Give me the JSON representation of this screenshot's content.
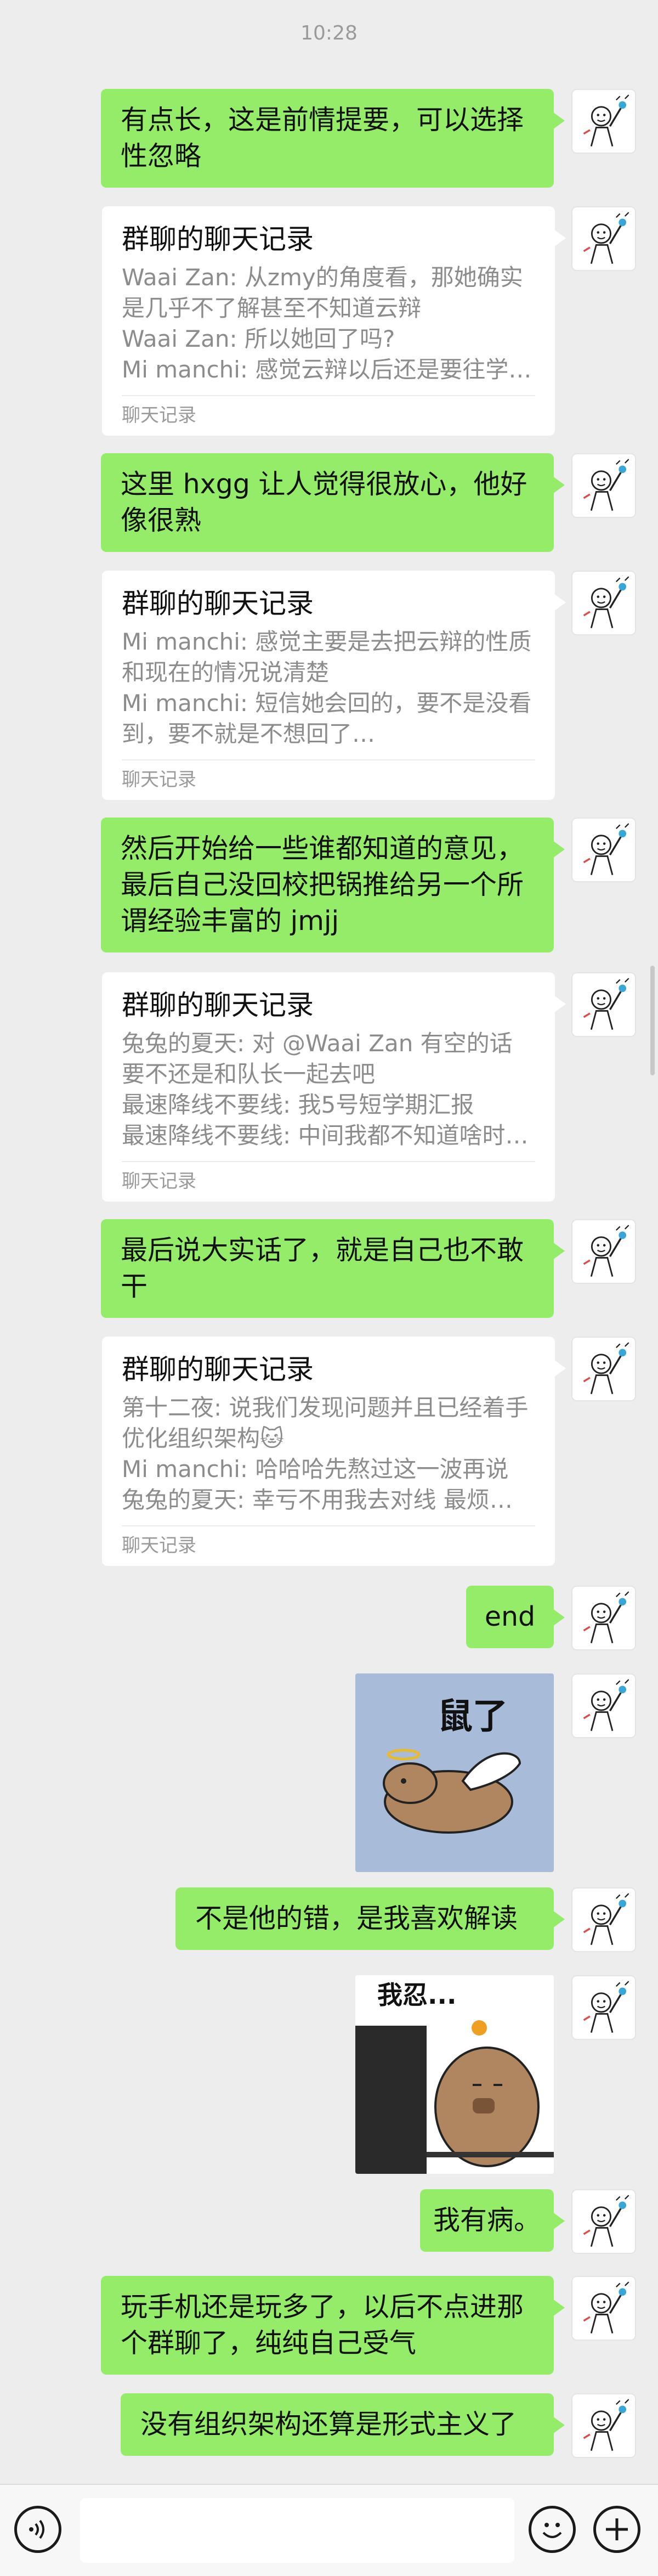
{
  "status": {
    "time": "10:28"
  },
  "messages": [
    {
      "type": "text",
      "text": "有点长，这是前情提要，可以选择性忽略"
    },
    {
      "type": "card",
      "title": "群聊的聊天记录",
      "lines": [
        "Waai Zan: 从zmy的角度看，那她确实是几乎不了解甚至不知道云辩",
        "Waai Zan: 所以她回了吗?",
        "Mi manchi: 感觉云辩以后还是要往学园…"
      ],
      "footer": "聊天记录"
    },
    {
      "type": "text",
      "text": "这里 hxgg 让人觉得很放心，他好像很熟"
    },
    {
      "type": "card",
      "title": "群聊的聊天记录",
      "lines": [
        "Mi manchi: 感觉主要是去把云辩的性质和现在的情况说清楚",
        "Mi manchi: 短信她会回的，要不是没看到，要不就是不想回了…"
      ],
      "footer": "聊天记录"
    },
    {
      "type": "text",
      "text": "然后开始给一些谁都知道的意见，最后自己没回校把锅推给另一个所谓经验丰富的 jmjj"
    },
    {
      "type": "card",
      "title": "群聊的聊天记录",
      "lines": [
        "兔兔的夏天: 对 @Waai Zan 有空的话要不还是和队长一起去吧",
        "最速降线不要线: 我5号短学期汇报",
        "最速降线不要线: 中间我都不知道啥时…"
      ],
      "footer": "聊天记录"
    },
    {
      "type": "text",
      "text": "最后说大实话了，就是自己也不敢干"
    },
    {
      "type": "card",
      "title": "群聊的聊天记录",
      "lines": [
        "第十二夜: 说我们发现问题并且已经着手优化组织架构🐱",
        "Mi manchi: 哈哈哈先熬过这一波再说",
        "兔兔的夏天: 幸亏不用我去对线 最烦行…"
      ],
      "footer": "聊天记录"
    },
    {
      "type": "text",
      "text": "end"
    },
    {
      "type": "sticker",
      "caption": "鼠了",
      "icon": "capybara-angel-sticker"
    },
    {
      "type": "text",
      "text": "不是他的错，是我喜欢解读"
    },
    {
      "type": "sticker",
      "caption": "我忍...",
      "icon": "capybara-computer-sticker"
    },
    {
      "type": "text",
      "text": "我有病。"
    },
    {
      "type": "text",
      "text": "玩手机还是玩多了，以后不点进那个群聊了，纯纯自己受气"
    },
    {
      "type": "text",
      "text": "没有组织架构还算是形式主义了"
    }
  ],
  "input_bar": {
    "placeholder": "",
    "voice_icon": "voice-icon",
    "emoji_icon": "emoji-icon",
    "plus_icon": "plus-icon"
  },
  "colors": {
    "bubble": "#95ec69",
    "background": "#ededed",
    "card": "#ffffff"
  }
}
